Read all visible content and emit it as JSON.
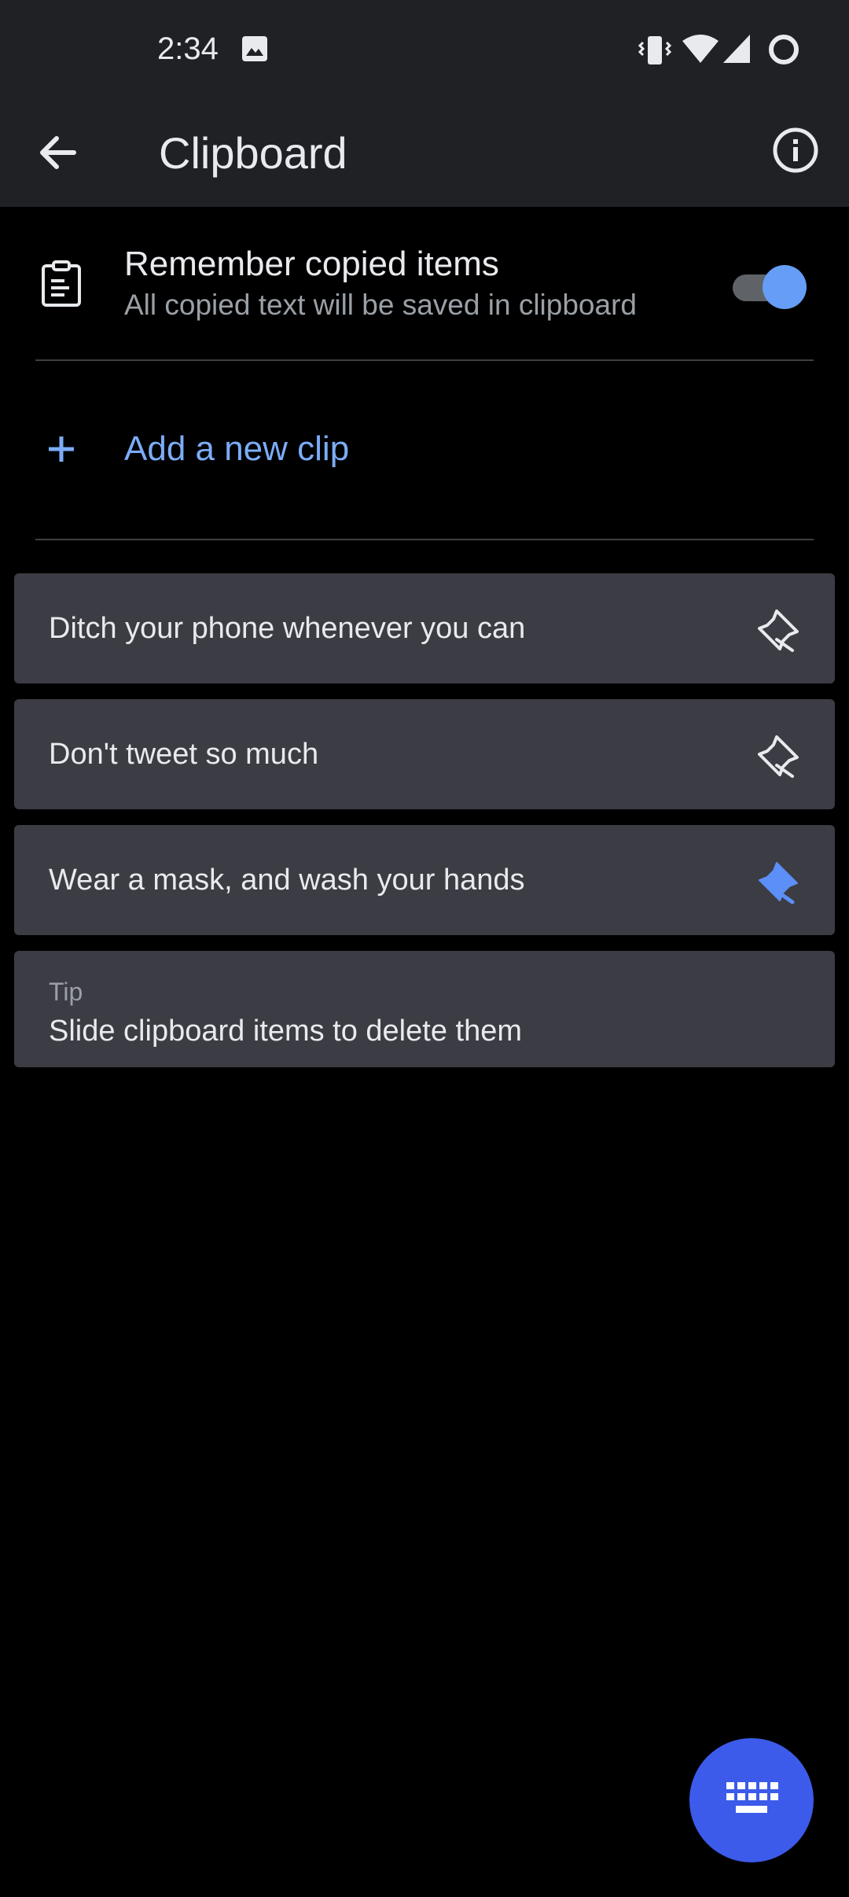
{
  "status_bar": {
    "time": "2:34",
    "icons": [
      "photo-icon",
      "vibrate-icon",
      "wifi-icon",
      "signal-icon",
      "battery-icon"
    ]
  },
  "app_bar": {
    "title": "Clipboard",
    "back_icon": "arrow-back-icon",
    "info_icon": "info-icon"
  },
  "remember": {
    "title": "Remember copied items",
    "subtitle": "All copied text will be saved in clipboard",
    "icon": "clipboard-icon",
    "enabled": true
  },
  "add_clip": {
    "label": "Add a new clip",
    "icon": "plus-icon"
  },
  "clips": [
    {
      "text": "Ditch your phone whenever you can",
      "pinned": false
    },
    {
      "text": "Don't tweet so much",
      "pinned": false
    },
    {
      "text": "Wear a mask, and wash your hands",
      "pinned": true
    }
  ],
  "tip": {
    "label": "Tip",
    "text": "Slide clipboard items to delete them"
  },
  "fab": {
    "icon": "keyboard-icon"
  },
  "colors": {
    "background": "#000000",
    "bar": "#202124",
    "card": "#3c3c44",
    "accent": "#7cacf8",
    "toggle_on": "#669df6",
    "fab": "#3c5bea",
    "pinned": "#5c8ff7"
  }
}
